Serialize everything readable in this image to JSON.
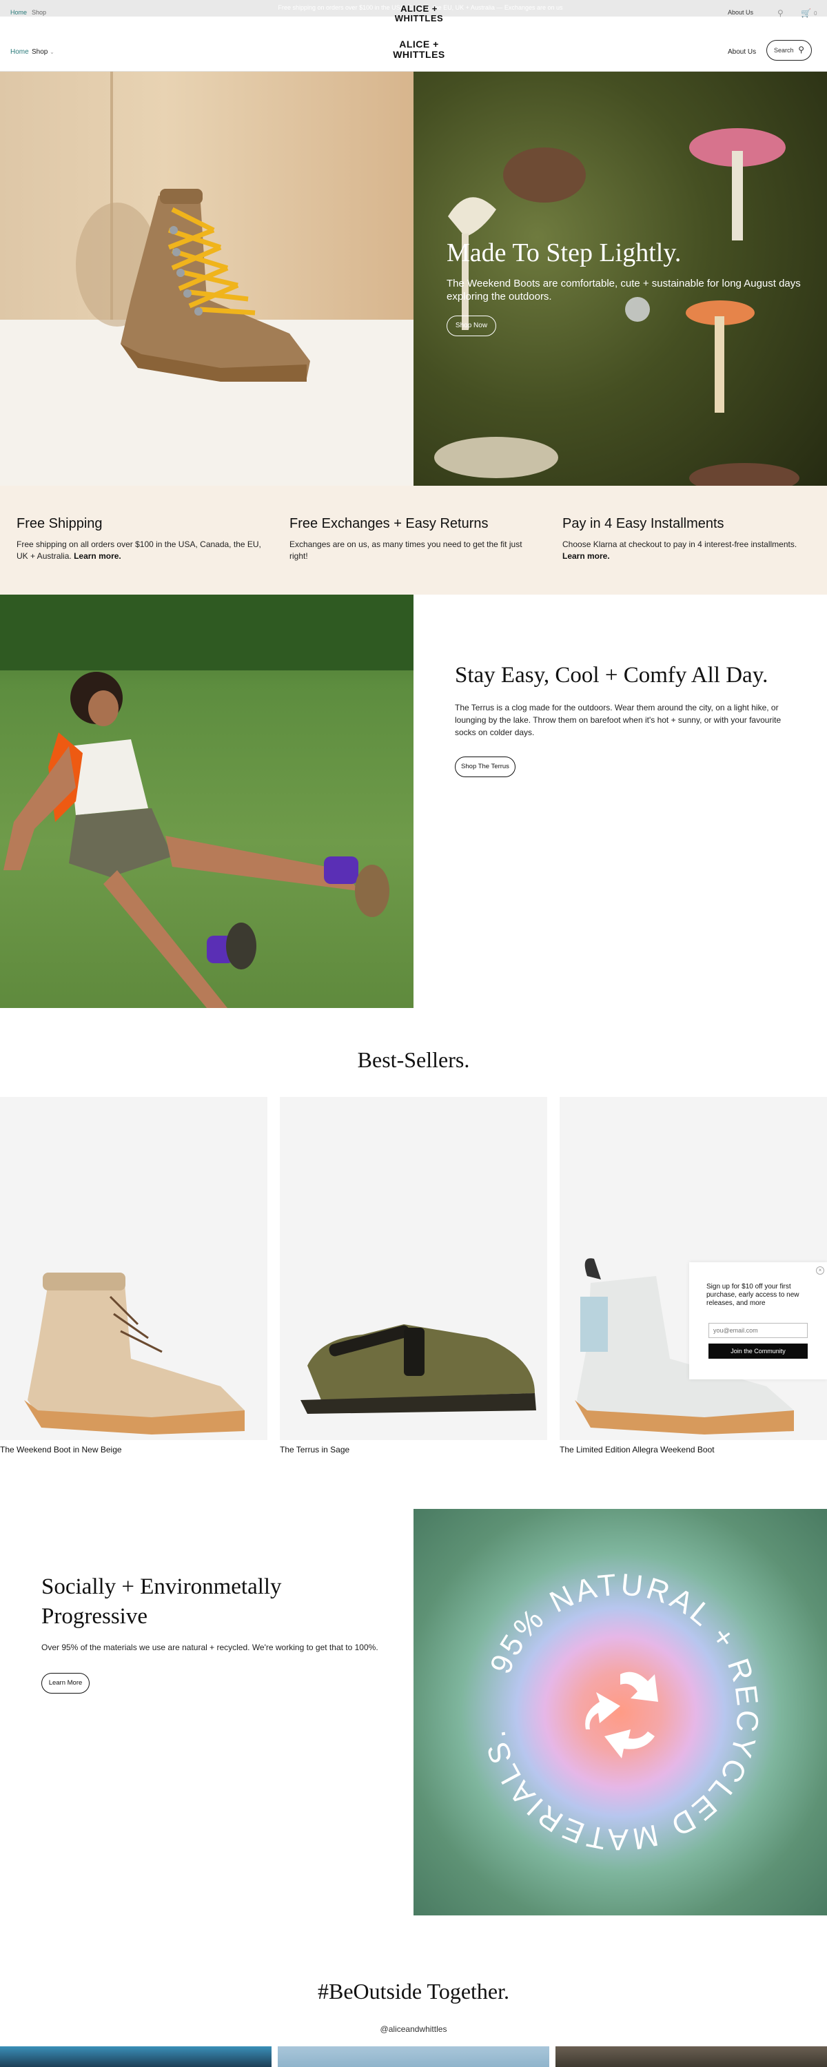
{
  "ghost_bar": {
    "home": "Home",
    "shop": "Shop",
    "announcement": "Free shipping on orders over $100 in the USA, Canada, the EU, UK + Australia — Exchanges are on us",
    "about": "About Us",
    "cart_count": "0"
  },
  "header": {
    "logo_line1": "ALICE +",
    "logo_line2": "WHITTLES",
    "nav_home": "Home",
    "nav_shop": "Shop",
    "about": "About Us",
    "search_label": "Search"
  },
  "hero": {
    "title": "Made To Step Lightly.",
    "subtitle": "The Weekend Boots are comfortable, cute + sustainable for long August days exploring the outdoors.",
    "button": "Shop Now"
  },
  "features": [
    {
      "title": "Free Shipping",
      "text": "Free shipping on all orders over $100 in the USA, Canada, the EU, UK + Australia.",
      "link": "Learn more."
    },
    {
      "title": "Free Exchanges + Easy Returns",
      "text": "Exchanges are on us, as many times you need to get the fit just right!",
      "link": ""
    },
    {
      "title": "Pay in 4 Easy Installments",
      "text": "Choose Klarna at checkout to pay in 4 interest-free installments.",
      "link": "Learn more."
    }
  ],
  "terrus": {
    "title": "Stay Easy, Cool + Comfy All Day.",
    "body": "The Terrus is a clog made for the outdoors. Wear them around the city, on a light hike, or lounging by the lake. Throw them on barefoot when it's hot + sunny, or with your favourite socks on colder days.",
    "button": "Shop The Terrus"
  },
  "best_sellers": {
    "title": "Best-Sellers.",
    "products": [
      {
        "name": "The Weekend Boot in New Beige"
      },
      {
        "name": "The Terrus in Sage"
      },
      {
        "name": "The Limited Edition Allegra Weekend Boot"
      }
    ]
  },
  "popup": {
    "text": "Sign up for $10 off your first purchase, early access to new releases, and more",
    "email_placeholder": "you@email.com",
    "button": "Join the Community",
    "close": "×"
  },
  "social": {
    "title": "Socially + Environmetally Progressive",
    "body": "Over 95% of the materials we use are natural + recycled. We're working to get that to 100%.",
    "button": "Learn More",
    "ring_text": "95% NATURAL + RECYCLED MATERIALS."
  },
  "community": {
    "title": "#BeOutside Together.",
    "handle": "@aliceandwhittles"
  },
  "colors": {
    "accent_link": "#2a7a7a",
    "feature_bg": "#f7efe5",
    "card_bg": "#f4f4f4"
  }
}
